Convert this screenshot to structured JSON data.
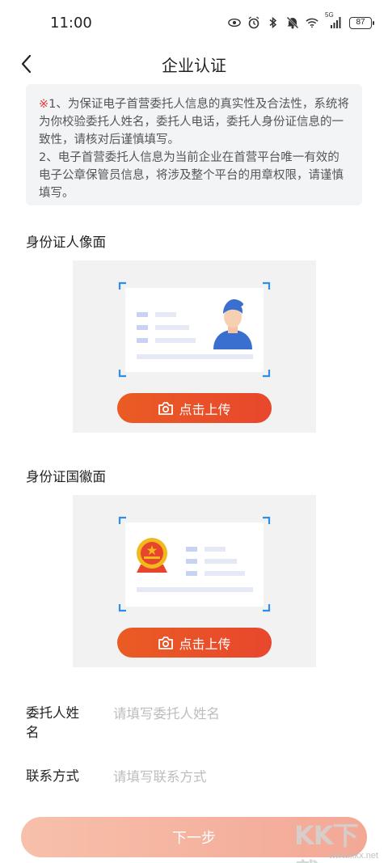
{
  "status_bar": {
    "time": "11:00",
    "battery": "87",
    "signal_label": "5G",
    "icons": [
      "eye-icon",
      "alarm-icon",
      "bluetooth-icon",
      "mute-icon",
      "wifi-icon",
      "signal-icon",
      "battery-icon"
    ]
  },
  "header": {
    "title": "企业认证",
    "back_icon": "chevron-left-icon"
  },
  "notice": {
    "mark": "※",
    "line1": "1、为保证电子首营委托人信息的真实性及合法性，系统将为你校验委托人姓名，委托人电话，委托人身份证信息的一致性，请核对后谨慎填写。",
    "line2": "2、电子首营委托人信息为当前企业在首营平台唯一有效的电子公章保管员信息，将涉及整个平台的用章权限，请谨慎填写。"
  },
  "id_front": {
    "label": "身份证人像面",
    "upload_label": "点击上传",
    "icon": "camera-icon"
  },
  "id_back": {
    "label": "身份证国徽面",
    "upload_label": "点击上传",
    "icon": "camera-icon"
  },
  "form": {
    "name_label": "委托人姓名",
    "name_placeholder": "请填写委托人姓名",
    "name_value": "",
    "contact_label": "联系方式",
    "contact_placeholder": "请填写联系方式",
    "contact_value": ""
  },
  "footer": {
    "next_label": "下一步"
  },
  "watermark": {
    "logo_text": "KK下载",
    "url": "www.kkx.net"
  },
  "colors": {
    "accent": "#e8522a",
    "next_button": "#f5b3a0",
    "notice_bg": "#f3f4f6",
    "card_bg": "#f2f2f3",
    "frame_corner": "#2f8fe6",
    "avatar_blue": "#3a6fd0",
    "emblem_red": "#e7452c"
  }
}
